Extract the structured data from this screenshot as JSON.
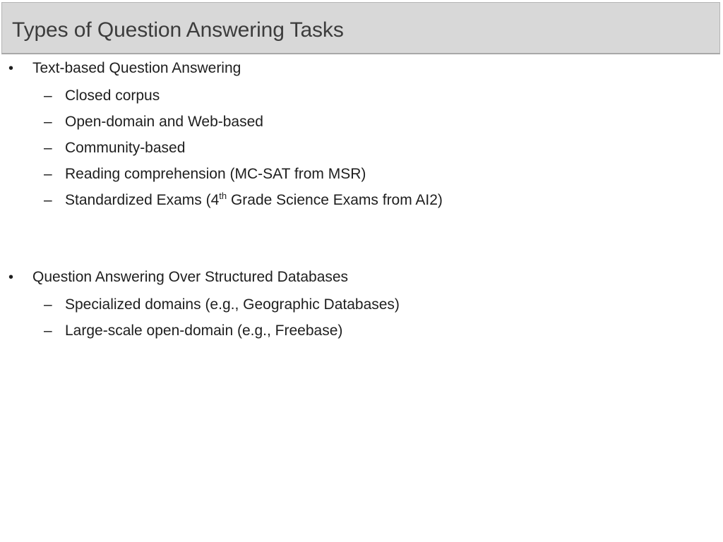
{
  "slide": {
    "title": "Types of Question Answering Tasks",
    "title_bar_color": "#d8d8d8",
    "title_text_color": "#3c3c3c",
    "body_text_color": "#1e1e1e",
    "background_color": "#ffffff",
    "bullet_marker_level1": "•",
    "bullet_marker_level2": "–",
    "groups": [
      {
        "heading": "Text-based Question Answering",
        "items": [
          {
            "text": "Closed corpus"
          },
          {
            "text": "Open-domain and Web-based"
          },
          {
            "text": "Community-based"
          },
          {
            "text": "Reading comprehension (MC-SAT from MSR)"
          },
          {
            "prefix": "Standardized Exams (4",
            "sup": "th",
            "suffix": " Grade Science Exams from AI2)"
          }
        ]
      },
      {
        "heading": "Question Answering Over Structured Databases",
        "items": [
          {
            "text": "Specialized domains (e.g., Geographic Databases)"
          },
          {
            "text": "Large-scale open-domain (e.g., Freebase)"
          }
        ]
      }
    ]
  }
}
